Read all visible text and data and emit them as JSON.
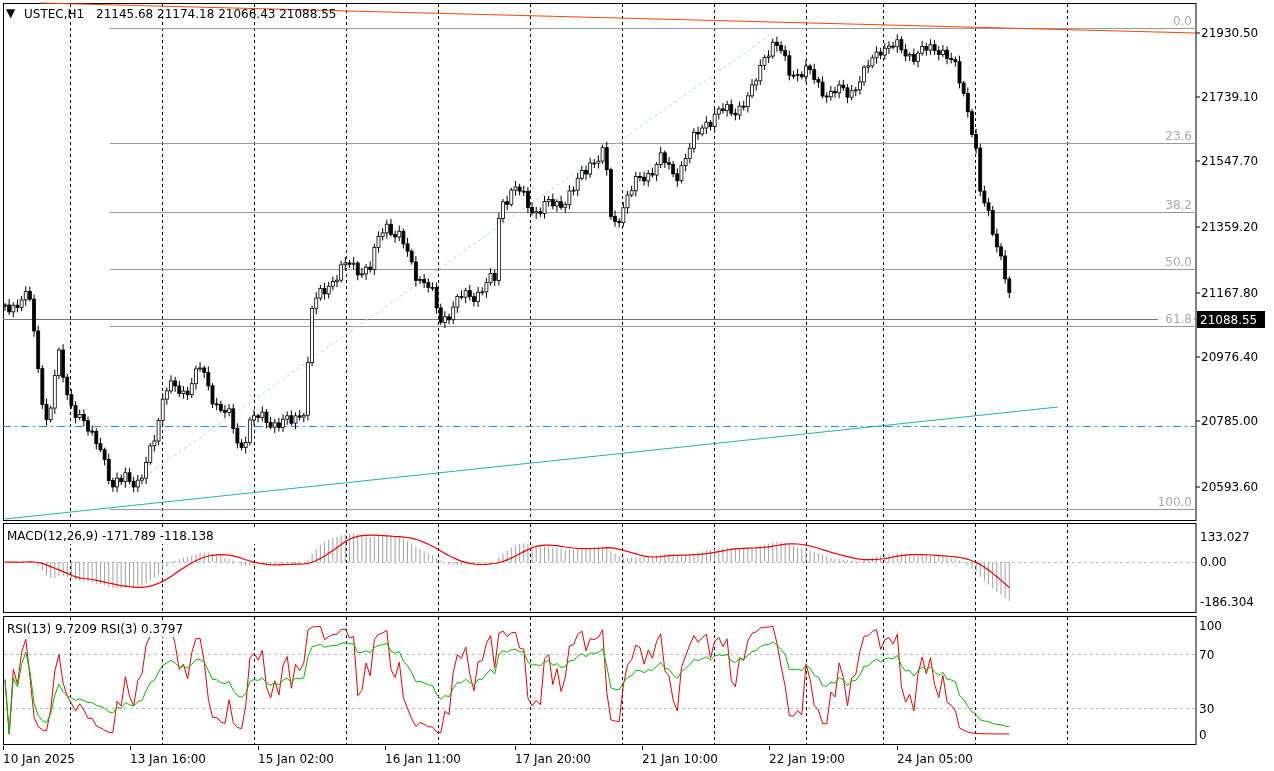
{
  "header": {
    "menu_glyph": "▼",
    "symbol": "USTEC,H1",
    "ohlc": "21145.68 21174.18 21066.43 21088.55"
  },
  "price_axis": [
    "21930.50",
    "21739.10",
    "21547.70",
    "21359.20",
    "21167.80",
    "20976.40",
    "20785.00",
    "20593.60"
  ],
  "current_price": "21088.55",
  "fib_levels": [
    "0.0",
    "23.6",
    "38.2",
    "50.0",
    "61.8",
    "100.0"
  ],
  "macd": {
    "label": "MACD(12,26,9) -171.789 -118.138",
    "axis": [
      "133.027",
      "0.00",
      "-186.304"
    ]
  },
  "rsi": {
    "label": "RSI(13) 9.7209  RSI(3) 0.3797",
    "axis": [
      "100",
      "70",
      "30",
      "0"
    ]
  },
  "time_axis": [
    "10 Jan 2025",
    "13 Jan 16:00",
    "15 Jan 02:00",
    "16 Jan 11:00",
    "17 Jan 20:00",
    "21 Jan 10:00",
    "22 Jan 19:00",
    "24 Jan 05:00"
  ]
}
